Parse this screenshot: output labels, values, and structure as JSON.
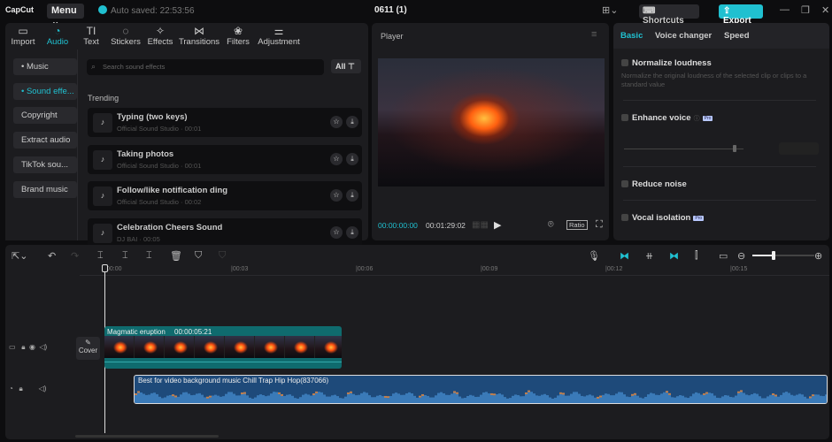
{
  "app": {
    "logo": "CapCut",
    "menu": "Menu ⌄",
    "autosave": "Auto saved: 22:53:56",
    "project_title": "0611 (1)",
    "shortcuts": "Shortcuts",
    "export": "Export"
  },
  "tabs": [
    {
      "label": "Import",
      "icon": "▭"
    },
    {
      "label": "Audio",
      "icon": "◔"
    },
    {
      "label": "Text",
      "icon": "TI"
    },
    {
      "label": "Stickers",
      "icon": "◌"
    },
    {
      "label": "Effects",
      "icon": "✧"
    },
    {
      "label": "Transitions",
      "icon": "⋈"
    },
    {
      "label": "Filters",
      "icon": "❀"
    },
    {
      "label": "Adjustment",
      "icon": "⚌"
    }
  ],
  "sidebar": [
    "• Music",
    "• Sound effe...",
    "Copyright",
    "Extract audio",
    "TikTok sou...",
    "Brand music"
  ],
  "search": {
    "placeholder": "Search sound effects",
    "filter": "All"
  },
  "trending_label": "Trending",
  "sounds": [
    {
      "name": "Typing (two keys)",
      "sub": "Official Sound Studio · 00:01"
    },
    {
      "name": "Taking photos",
      "sub": "Official Sound Studio · 00:01"
    },
    {
      "name": "Follow/like notification ding",
      "sub": "Official Sound Studio · 00:02"
    },
    {
      "name": "Celebration Cheers Sound",
      "sub": "DJ BAI · 00:05"
    }
  ],
  "player": {
    "title": "Player",
    "current": "00:00:00:00",
    "total": "00:01:29:02",
    "ratio": "Ratio"
  },
  "right": {
    "tabs": [
      "Basic",
      "Voice changer",
      "Speed"
    ],
    "normalize": "Normalize loudness",
    "normalize_desc": "Normalize the original loudness of the selected clip or clips to a standard value",
    "enhance": "Enhance voice",
    "reduce": "Reduce noise",
    "isolation": "Vocal isolation",
    "pro": "Pro",
    "slider_value": 0.6
  },
  "ruler": [
    "00:00",
    "|00:03",
    "|00:06",
    "|00:09",
    "|00:12",
    "|00:15"
  ],
  "video_clip": {
    "name": "Magmatic eruption",
    "duration": "00:00:05:21"
  },
  "cover": "Cover",
  "audio_clip": {
    "name": "Best for video background music Chill Trap Hip Hop(837066)"
  },
  "colors": {
    "accent": "#20c0d0",
    "video_track": "#0f6b6e",
    "audio_track": "#1e4a7a"
  }
}
